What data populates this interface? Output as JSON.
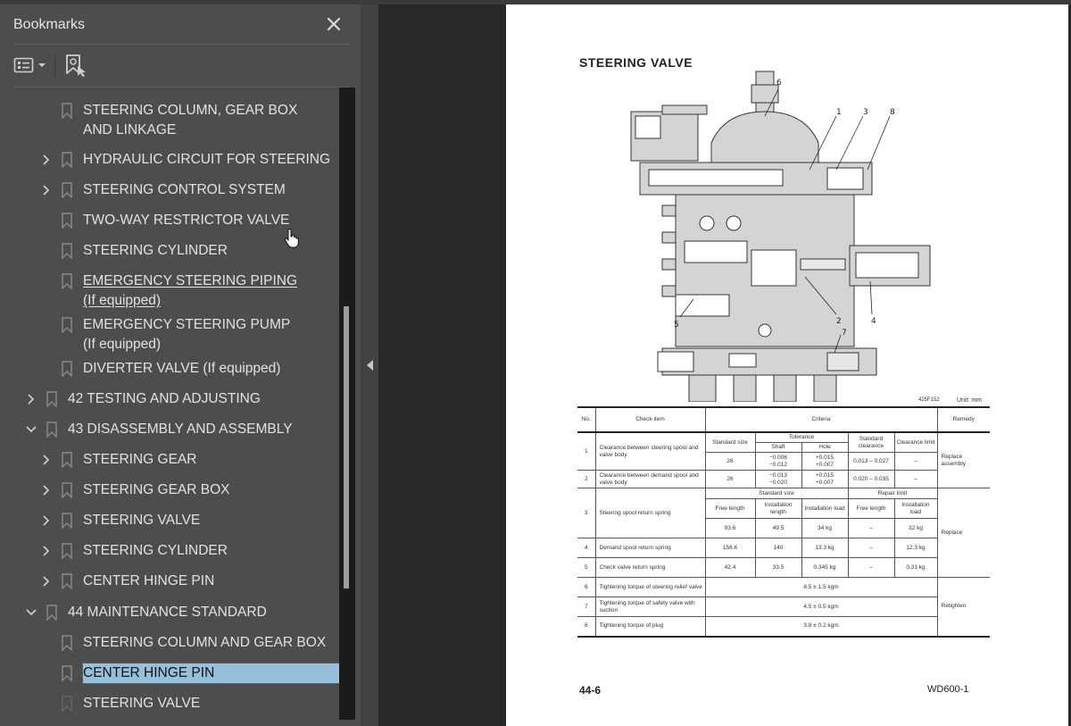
{
  "panel": {
    "title": "Bookmarks",
    "close_icon": "close-icon",
    "options_icon": "list-options-icon",
    "new_bookmark_icon": "new-bookmark-icon"
  },
  "bookmarks": [
    {
      "label": "STEERING COLUMN, GEAR BOX AND LINKAGE",
      "level": 2,
      "expandable": false,
      "expanded": false
    },
    {
      "label": "HYDRAULIC CIRCUIT FOR STEERING",
      "level": 2,
      "expandable": true,
      "expanded": false
    },
    {
      "label": "STEERING CONTROL SYSTEM",
      "level": 2,
      "expandable": true,
      "expanded": false
    },
    {
      "label": "TWO-WAY RESTRICTOR VALVE",
      "level": 2,
      "expandable": false,
      "expanded": false
    },
    {
      "label": "STEERING CYLINDER",
      "level": 2,
      "expandable": false,
      "expanded": false
    },
    {
      "label": "EMERGENCY STEERING PIPING (If equipped)",
      "level": 2,
      "expandable": false,
      "expanded": false,
      "hovered": true
    },
    {
      "label": "EMERGENCY STEERING PUMP (If equipped)",
      "level": 2,
      "expandable": false,
      "expanded": false
    },
    {
      "label": "DIVERTER VALVE (If equipped)",
      "level": 2,
      "expandable": false,
      "expanded": false
    },
    {
      "label": "42 TESTING AND ADJUSTING",
      "level": 1,
      "expandable": true,
      "expanded": false
    },
    {
      "label": "43 DISASSEMBLY AND ASSEMBLY",
      "level": 1,
      "expandable": true,
      "expanded": true
    },
    {
      "label": "STEERING GEAR",
      "level": 2,
      "expandable": true,
      "expanded": false
    },
    {
      "label": "STEERING GEAR BOX",
      "level": 2,
      "expandable": true,
      "expanded": false
    },
    {
      "label": "STEERING VALVE",
      "level": 2,
      "expandable": true,
      "expanded": false
    },
    {
      "label": "STEERING CYLINDER",
      "level": 2,
      "expandable": true,
      "expanded": false
    },
    {
      "label": "CENTER HINGE PIN",
      "level": 2,
      "expandable": true,
      "expanded": false
    },
    {
      "label": "44 MAINTENANCE STANDARD",
      "level": 1,
      "expandable": true,
      "expanded": true
    },
    {
      "label": "STEERING COLUMN AND GEAR BOX",
      "level": 2,
      "expandable": false,
      "expanded": false
    },
    {
      "label": "CENTER HINGE PIN",
      "level": 2,
      "expandable": false,
      "expanded": false,
      "selected": true
    },
    {
      "label": "STEERING VALVE",
      "level": 2,
      "expandable": false,
      "expanded": false
    }
  ],
  "colors": {
    "panel_bg": "#4d4d4d",
    "selection": "#95c0dc",
    "viewer_bg": "#282828"
  },
  "document": {
    "title": "STEERING VALVE",
    "callouts": [
      "6",
      "1",
      "3",
      "8",
      "5",
      "2",
      "4",
      "7"
    ],
    "figure_code": "425F152",
    "unit": "Unit: mm",
    "table": {
      "headers": {
        "no": "No.",
        "check_item": "Check item",
        "criteria": "Criteria",
        "remedy": "Remedy"
      },
      "sub_headers_1": {
        "standard_size": "Standard size",
        "tolerance": "Tolerance",
        "shaft": "Shaft",
        "hole": "Hole",
        "standard_clearance": "Standard clearance",
        "clearance_limit": "Clearance limit"
      },
      "sub_headers_2": {
        "standard_size": "Standard size",
        "repair_limit": "Repair limit",
        "free_length": "Free length",
        "installation_length": "Installation length",
        "installation_load": "Installation load",
        "rl_free_length": "Free length",
        "rl_installation_load": "Installation load"
      },
      "rows": [
        {
          "no": "1",
          "item": "Clearance between steering spool and valve body",
          "size": "26",
          "shaft": "−0.006\n−0.012",
          "hole": "+0.015\n+0.007",
          "std_clear": "0.013 – 0.027",
          "limit": "–"
        },
        {
          "no": "2",
          "item": "Clearance between demand spool and valve body",
          "size": "26",
          "shaft": "−0.013\n−0.020",
          "hole": "+0.015\n+0.007",
          "std_clear": "0.020 – 0.035",
          "limit": "–"
        },
        {
          "no": "3",
          "item": "Steering spool return spring",
          "free_length": "93.6",
          "inst_length": "49.5",
          "inst_load": "34 kg",
          "rl_free": "–",
          "rl_load": "32 kg"
        },
        {
          "no": "4",
          "item": "Demand spool return spring",
          "free_length": "156.6",
          "inst_length": "140",
          "inst_load": "13.3 kg",
          "rl_free": "–",
          "rl_load": "12.3 kg"
        },
        {
          "no": "5",
          "item": "Check valve return spring",
          "free_length": "42.4",
          "inst_length": "33.5",
          "inst_load": "0.345 kg",
          "rl_free": "–",
          "rl_load": "0.31 kg"
        },
        {
          "no": "6",
          "item": "Tightening torque of steering relief valve",
          "value": "8.5 ± 1.5 kgm"
        },
        {
          "no": "7",
          "item": "Tightening torque of safety valve with suction",
          "value": "4.5 ± 0.5 kgm"
        },
        {
          "no": "8",
          "item": "Tightening torque of plug",
          "value": "3.8 ± 0.2 kgm"
        }
      ],
      "remedies": {
        "replace_assembly": "Replace assembly",
        "replace": "Replace",
        "retighten": "Retighten"
      }
    },
    "page_number": "44-6",
    "model": "WD600-1"
  }
}
